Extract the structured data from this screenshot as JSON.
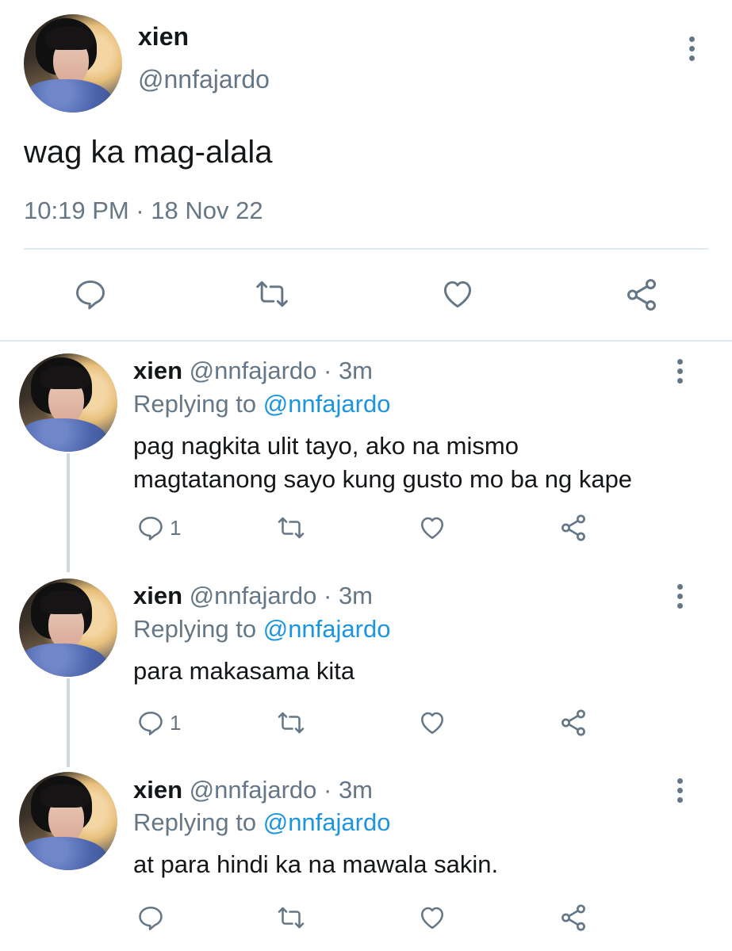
{
  "main_tweet": {
    "author_name": "xien",
    "handle": "@nnfajardo",
    "text": "wag ka mag-alala",
    "timestamp": "10:19 PM · 18 Nov 22",
    "actions": {
      "reply_icon": "reply-icon",
      "retweet_icon": "retweet-icon",
      "like_icon": "like-icon",
      "share_icon": "share-icon"
    }
  },
  "replies": [
    {
      "author_name": "xien",
      "handle_time": "@nnfajardo · 3m",
      "replying_label": "Replying to",
      "replying_handle": "@nnfajardo",
      "text_line1": "pag nagkita ulit tayo, ako na mismo",
      "text_line2": "magtatanong sayo kung gusto mo ba ng kape",
      "reply_count": "1"
    },
    {
      "author_name": "xien",
      "handle_time": "@nnfajardo · 3m",
      "replying_label": "Replying to",
      "replying_handle": "@nnfajardo",
      "text_line1": "para makasama kita",
      "reply_count": "1"
    },
    {
      "author_name": "xien",
      "handle_time": "@nnfajardo · 3m",
      "replying_label": "Replying to",
      "replying_handle": "@nnfajardo",
      "text_line1": "at para hindi ka na mawala sakin.",
      "reply_count": ""
    }
  ],
  "colors": {
    "text": "#14171a",
    "secondary": "#657786",
    "link": "#1b95e0",
    "divider": "#e1e8ed"
  }
}
